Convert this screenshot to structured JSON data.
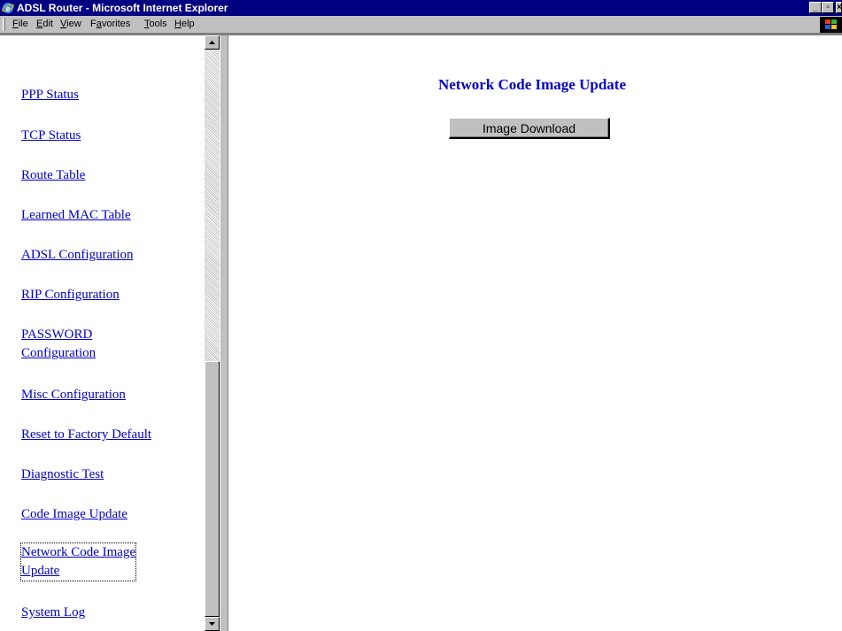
{
  "window": {
    "title": "ADSL Router - Microsoft Internet Explorer",
    "controls": {
      "minimize": "_",
      "maximize": "▫",
      "close": "×"
    }
  },
  "menubar": {
    "items": [
      {
        "label_ul": "F",
        "label_rest": "ile"
      },
      {
        "label_ul": "E",
        "label_rest": "dit"
      },
      {
        "label_ul": "V",
        "label_rest": "iew"
      },
      {
        "label_pre": "F",
        "label_ul": "a",
        "label_rest": "vorites"
      },
      {
        "label_ul": "T",
        "label_rest": "ools"
      },
      {
        "label_ul": "H",
        "label_rest": "elp"
      }
    ]
  },
  "nav": {
    "links": [
      {
        "label": "PPP Status"
      },
      {
        "label": "TCP Status"
      },
      {
        "label": "Route Table"
      },
      {
        "label": "Learned MAC Table"
      },
      {
        "label": "ADSL Configuration"
      },
      {
        "label": "RIP Configuration"
      },
      {
        "line1": "PASSWORD",
        "line2": "Configuration"
      },
      {
        "label": "Misc Configuration"
      },
      {
        "label": "Reset to Factory Default"
      },
      {
        "label": "Diagnostic Test"
      },
      {
        "label": "Code Image Update"
      },
      {
        "line1": "Network Code Image",
        "line2": "Update"
      },
      {
        "label": "System Log"
      }
    ],
    "active_index": 11
  },
  "main": {
    "heading": "Network Code Image Update",
    "download_button": "Image Download"
  },
  "colors": {
    "titlebar": "#000080",
    "link": "#0000cc",
    "chrome": "#c0c0c0"
  },
  "icons": {
    "app": "internet-explorer-icon",
    "brand": "windows-logo-icon"
  }
}
